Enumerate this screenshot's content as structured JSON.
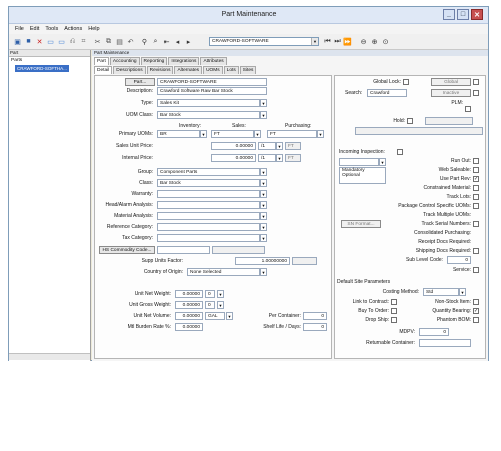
{
  "window": {
    "title": "Part Maintenance"
  },
  "menu": [
    "File",
    "Edit",
    "Tools",
    "Actions",
    "Help"
  ],
  "toolbar": {
    "company": "CRAWFORD-SOFTWARE"
  },
  "left_panel": {
    "header": "Part",
    "tree_root": "Parts",
    "selected_part": "CRAWFORD-SOFTHA..."
  },
  "main_header": "Part Maintenance",
  "tabs_top": [
    "Part",
    "Accounting",
    "Reporting",
    "Integrations",
    "Attributes"
  ],
  "tabs_bottom": [
    "Detail",
    "Descriptions",
    "Revisions",
    "Alternates",
    "UOMs",
    "Lots",
    "Sites"
  ],
  "part": {
    "part_button": "Part...",
    "part_value": "CRAWFORD-SOFTWARE",
    "description_label": "Description:",
    "description_value": "Crawford Software Raw Bar Stock",
    "type_label": "Type:",
    "type_value": "Sales Kit",
    "uom_class_label": "UOM Class:",
    "uom_class_value": "Bar Stock",
    "inventory_hdr": "Inventory:",
    "sales_hdr": "Sales:",
    "purchasing_hdr": "Purchasing:",
    "primary_uoms_label": "Primary UOMs:",
    "primary_inv": "BR",
    "primary_sales": "FT",
    "primary_purch": "FT",
    "sales_unit_price_label": "Sales Unit Price:",
    "sales_unit_price": "0.00000",
    "sales_unit_per": "/1",
    "sales_unit_uom": "FT",
    "internal_price_label": "Internal Price:",
    "internal_price": "0.00000",
    "internal_per": "/1",
    "internal_uom": "FT",
    "group_label": "Group:",
    "group_value": "Component Parts",
    "class_label": "Class:",
    "class_value": "Bar Stock",
    "warranty_label": "Warranty:",
    "head_alarm_label": "Head/Alarm Analysis:",
    "material_analysis_label": "Material Analysis:",
    "reference_category_label": "Reference Category:",
    "tax_category_label": "Tax Category:",
    "hs_code_button": "HS Commodity Code...",
    "supp_units_factor_label": "Supp Units Factor:",
    "supp_units_factor": "1.00000000",
    "country_origin_label": "Country of Origin:",
    "country_origin_value": "None Selected",
    "unit_net_weight_label": "Unit Net Weight:",
    "unit_net_weight": "0.00000",
    "unit_net_weight_uom": "0",
    "unit_gross_weight_label": "Unit Gross Weight:",
    "unit_gross_weight": "0.00000",
    "unit_gross_weight_uom": "0",
    "unit_net_volume_label": "Unit Net Volume:",
    "unit_net_volume": "0.00000",
    "unit_net_volume_uom": "GAL",
    "mtl_burden_label": "Mtl Burden Rate %:",
    "mtl_burden": "0.00000",
    "per_container_label": "Per Container:",
    "per_container": "0",
    "shelf_life_label": "Shelf Life / Days:",
    "shelf_life": "0"
  },
  "right": {
    "global_lock_label": "Global Lock:",
    "global_button": "Global",
    "search_label": "Search:",
    "search_value": "Crawford",
    "inactive_button": "Inactive",
    "plm_label": "PLM:",
    "hold_label": "Hold:",
    "incoming_inspection_label": "Incoming Inspection:",
    "inspection_options": [
      "Mandatory",
      "Optional"
    ],
    "run_out_label": "Run Out:",
    "web_saleable_label": "Web Saleable:",
    "use_part_rev_label": "Use Part Rev:",
    "constrained_material_label": "Constrained Material:",
    "track_lots_label": "Track Lots:",
    "package_control_label": "Package Control Specific UOMs:",
    "track_multiple_uoms_label": "Track Multiple UOMs:",
    "sn_format_button": "SN Format...",
    "track_serial_label": "Track Serial Numbers:",
    "consolidated_purchasing_label": "Consolidated Purchasing:",
    "receipt_docs_label": "Receipt Docs Required:",
    "shipping_docs_label": "Shipping Docs Required:",
    "sub_level_code_label": "Sub Level Code:",
    "sub_level_code": "0",
    "service_label": "Service:",
    "default_site_params": "Default Site Parameters",
    "costing_method_label": "Costing Method:",
    "costing_method_value": "Std",
    "link_to_contract_label": "Link to Contract:",
    "non_stock_item_label": "Non-Stock Item:",
    "buy_to_order_label": "Buy To Order:",
    "quantity_bearing_label": "Quantity Bearing:",
    "drop_ship_label": "Drop Ship:",
    "phantom_bom_label": "Phantom BOM:",
    "mdpv_label": "MDPV:",
    "mdpv": "0",
    "returnable_container_label": "Returnable Container:"
  },
  "checked": {
    "use_part_rev": true,
    "quantity_bearing": true
  }
}
